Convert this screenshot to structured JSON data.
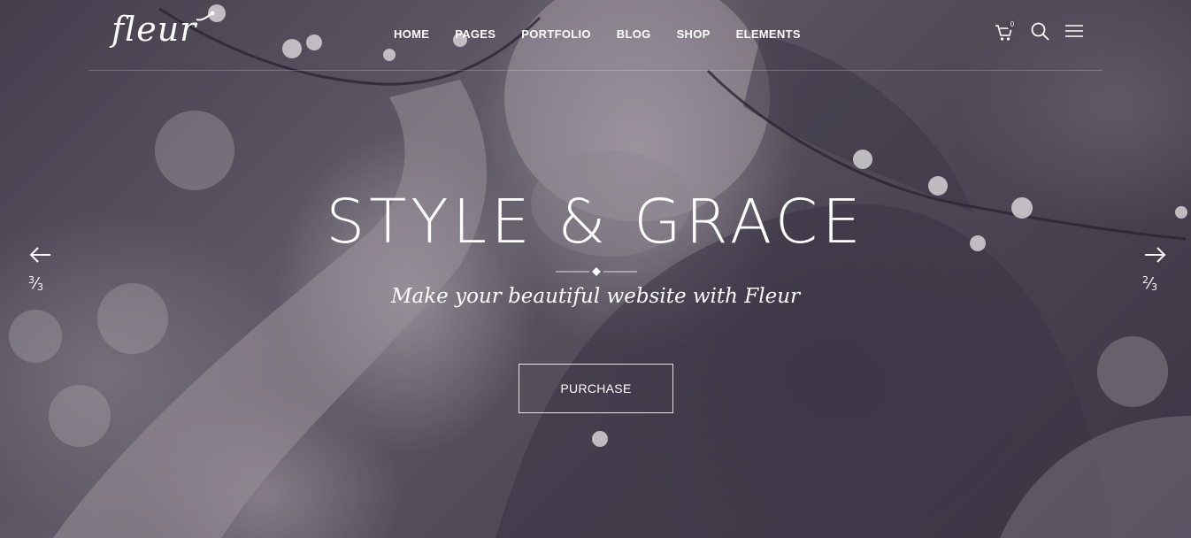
{
  "brand": {
    "logo_text": "fleur"
  },
  "nav": {
    "items": [
      {
        "label": "HOME"
      },
      {
        "label": "PAGES"
      },
      {
        "label": "PORTFOLIO"
      },
      {
        "label": "BLOG"
      },
      {
        "label": "SHOP"
      },
      {
        "label": "ELEMENTS"
      }
    ]
  },
  "header_icons": {
    "cart_icon": "shopping-cart-icon",
    "cart_count": "0",
    "search_icon": "search-icon",
    "menu_icon": "hamburger-menu-icon"
  },
  "slider": {
    "prev": {
      "icon": "arrow-left-icon",
      "current": "3",
      "total": "3"
    },
    "next": {
      "icon": "arrow-right-icon",
      "current": "2",
      "total": "3"
    }
  },
  "hero": {
    "headline": "STYLE & GRACE",
    "subtitle": "Make your beautiful website with Fleur",
    "cta_label": "PURCHASE"
  },
  "colors": {
    "text": "#ffffff",
    "overlay": "#4a4453"
  }
}
